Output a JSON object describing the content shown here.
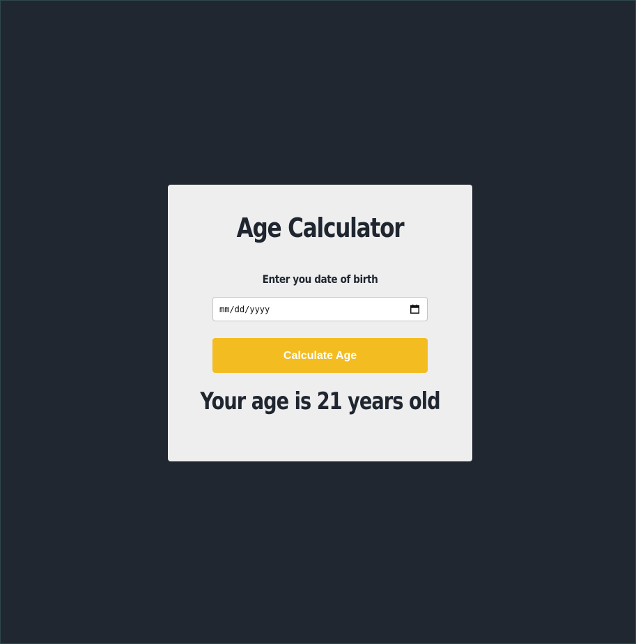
{
  "app": {
    "title": "Age Calculator"
  },
  "form": {
    "dob_label": "Enter you date of birth",
    "date_input": {
      "placeholder": "mm/dd/yyyy",
      "value": ""
    },
    "calendar_icon": "calendar-icon",
    "calculate_label": "Calculate Age"
  },
  "result": {
    "text": "Your age is 21 years old"
  },
  "colors": {
    "background": "#212730",
    "card": "#eeeeee",
    "text": "#1f2630",
    "accent": "#f3bd22",
    "button_text": "#ffffff"
  }
}
